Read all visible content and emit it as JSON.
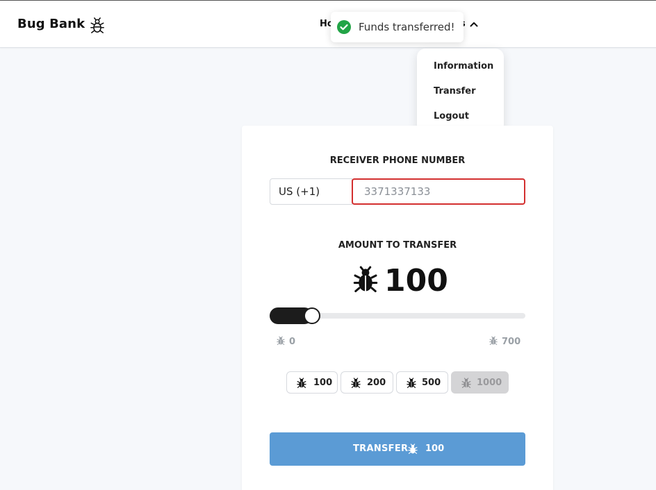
{
  "app": {
    "brand": "Bug Bank"
  },
  "nav": {
    "home_partial": "Ho",
    "account_partial": "s"
  },
  "toast": {
    "message": "Funds transferred!"
  },
  "menu": {
    "items": [
      "Information",
      "Transfer",
      "Logout"
    ]
  },
  "transfer_form": {
    "receiver_label": "RECEIVER PHONE NUMBER",
    "country_code": "US (+1)",
    "phone_placeholder": "3371337133",
    "amount_label": "AMOUNT TO TRANSFER",
    "amount": "100",
    "slider": {
      "min": "0",
      "max": "700",
      "value": 100
    },
    "presets": [
      {
        "label": "100",
        "disabled": false
      },
      {
        "label": "200",
        "disabled": false
      },
      {
        "label": "500",
        "disabled": false
      },
      {
        "label": "1000",
        "disabled": true
      }
    ],
    "submit_label": "TRANSFER",
    "submit_amount": "100"
  },
  "colors": {
    "accent": "#5b9bd5",
    "error": "#d32f2f",
    "success": "#22a447"
  },
  "icons": {
    "currency": "bug-icon",
    "brand": "bug-outline-icon",
    "toast": "check-circle-icon",
    "dropdown": "chevron-up-icon"
  }
}
